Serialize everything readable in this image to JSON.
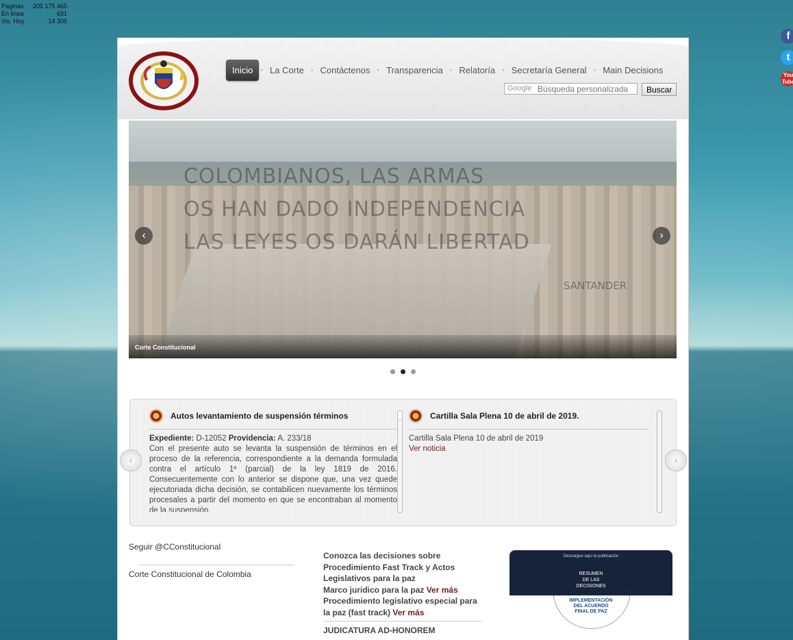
{
  "counter": {
    "rows": [
      {
        "label": "Paginas",
        "value": "205 175 465"
      },
      {
        "label": "En linea",
        "value": "631"
      },
      {
        "label": "Vis. Hoy",
        "value": "14 305"
      }
    ]
  },
  "social": {
    "facebook": "f",
    "twitter": "t",
    "youtube_line1": "You",
    "youtube_line2": "Tube",
    "icons": [
      "facebook-icon",
      "twitter-icon",
      "youtube-icon"
    ]
  },
  "nav": {
    "items": [
      "Inicio",
      "La Corte",
      "Contáctenos",
      "Transparencia",
      "Relatoría",
      "Secretaría General",
      "Main Decisions"
    ],
    "active_index": 0
  },
  "search": {
    "logo": "Google",
    "placeholder": "Búsqueda personalizada",
    "button": "Buscar"
  },
  "slider": {
    "text_lines": [
      "COLOMBIANOS, LAS ARMAS",
      "OS HAN DADO INDEPENDENCIA",
      "LAS LEYES OS DARÁN LIBERTAD"
    ],
    "santander": "SANTANDER",
    "caption": "Corte Constitucional",
    "prev_icon": "‹",
    "next_icon": "›",
    "dots": 3,
    "active_dot": 1
  },
  "news": [
    {
      "title": "Autos levantamiento de suspensión términos",
      "expediente_label": "Expediente:",
      "expediente": "D-12052",
      "providencia_label": "Providencia:",
      "providencia": "A. 233/18",
      "body": "Con el presente auto se levanta la suspensión de términos en el proceso de la referencia, correspondiente a la demanda formulada contra el artículo 1º (parcial) de la ley 1819 de 2016. Consecuentemente con lo anterior se dispone que, una vez quede ejecutoriada dicha decisión, se contabilicen nuevamente los términos procesales a partir del momento en que se encontraban al momento de la suspensión."
    },
    {
      "title": "Cartilla Sala Plena 10 de abril de 2019.",
      "body": "Cartilla Sala Plena 10 de abril de 2019",
      "link": "Ver noticia"
    }
  ],
  "footer": {
    "follow": "Seguir @CConstitucional",
    "fb_page": "Corte Constitucional de Colombia",
    "decisions_intro": "Conozca las decisiones sobre Procedimiento Fast Track y Actos Legislativos para la paz",
    "marco": "Marco juridico para la paz",
    "ver_mas_1": "Ver más",
    "procedimiento": "Procedimiento legislativo especial para la paz (fast track)",
    "ver_mas_2": "Ver más",
    "judicatura": "JUDICATURA AD-HONOREM"
  },
  "banner": {
    "small": "Descargue aquí la publicación",
    "title_1": "RESUMEN",
    "title_2": "DE LAS",
    "title_3": "DECISIONES",
    "sub_1": "IMPLEMENTACIÓN",
    "sub_2": "DEL ACUERDO",
    "sub_3": "FINAL DE PAZ"
  }
}
